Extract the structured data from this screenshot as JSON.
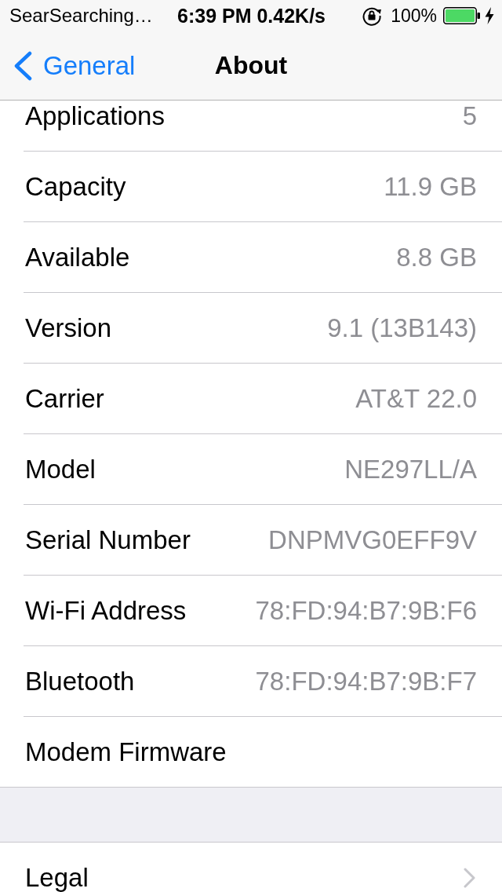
{
  "status_bar": {
    "carrier": "SearSearching…",
    "time": "6:39 PM 0.42K/s",
    "battery_percent": "100%"
  },
  "nav_bar": {
    "back_label": "General",
    "title": "About"
  },
  "sections": [
    {
      "rows": [
        {
          "kind": "info",
          "label": "Applications",
          "value": "5"
        },
        {
          "kind": "info",
          "label": "Capacity",
          "value": "11.9 GB"
        },
        {
          "kind": "info",
          "label": "Available",
          "value": "8.8 GB"
        },
        {
          "kind": "info",
          "label": "Version",
          "value": "9.1 (13B143)"
        },
        {
          "kind": "info",
          "label": "Carrier",
          "value": "AT&T 22.0"
        },
        {
          "kind": "info",
          "label": "Model",
          "value": "NE297LL/A"
        },
        {
          "kind": "info",
          "label": "Serial Number",
          "value": "DNPMVG0EFF9V"
        },
        {
          "kind": "info",
          "label": "Wi-Fi Address",
          "value": "78:FD:94:B7:9B:F6"
        },
        {
          "kind": "info",
          "label": "Bluetooth",
          "value": "78:FD:94:B7:9B:F7"
        },
        {
          "kind": "info",
          "label": "Modem Firmware"
        }
      ]
    },
    {
      "rows": [
        {
          "kind": "disclosure",
          "label": "Legal"
        }
      ]
    }
  ]
}
